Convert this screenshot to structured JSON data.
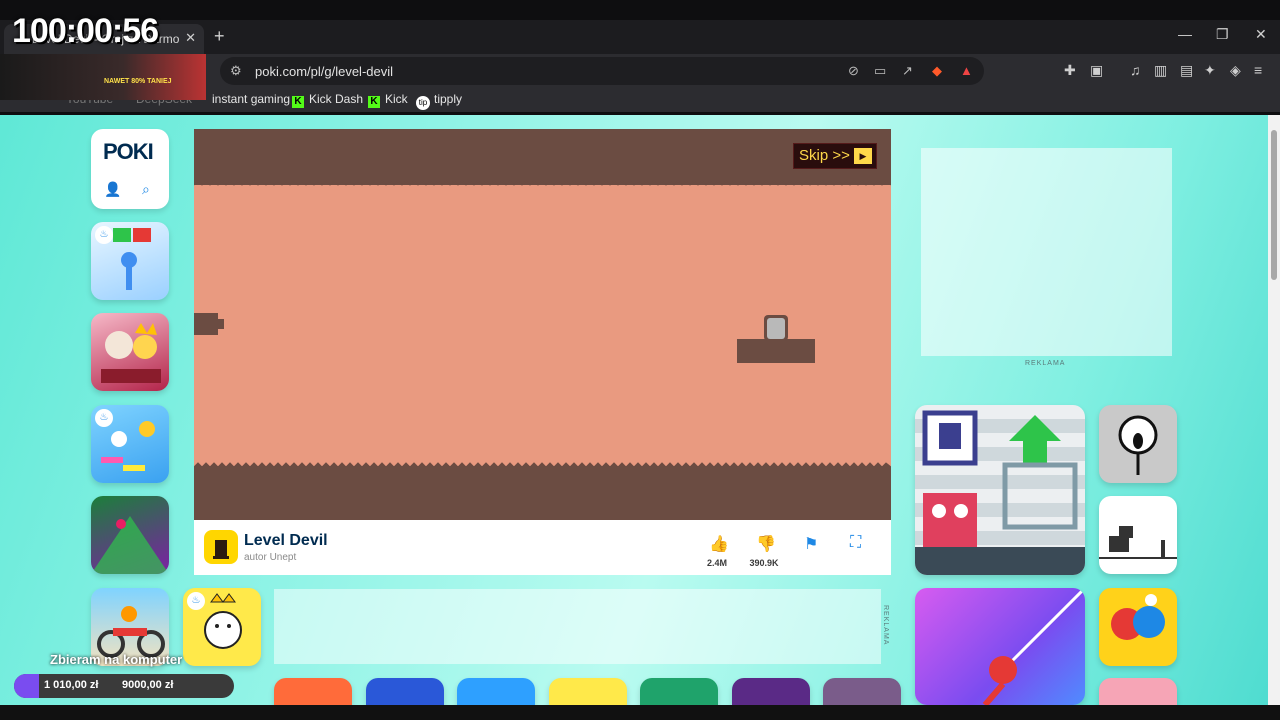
{
  "overlay": {
    "timer": "100:00:56",
    "promo_text": "NAWET 80% TANIEJ",
    "donation_label": "Zbieram na komputer",
    "donation_current": "1 010,00 zł",
    "donation_goal": "9000,00 zł",
    "donation_progress": 0.112
  },
  "browser": {
    "tab_title": "Level Devil - Graj za Darmo",
    "new_tab_symbol": "+",
    "url": "poki.com/pl/g/level-devil",
    "bookmarks": [
      {
        "label": "YouTube"
      },
      {
        "label": "DeepSeek"
      },
      {
        "label": "instant gaming"
      },
      {
        "label": "Kick Dash"
      },
      {
        "label": "Kick"
      },
      {
        "label": "tipply"
      }
    ]
  },
  "page": {
    "logo": "POKI",
    "skip_label": "Skip >>",
    "game": {
      "title": "Level Devil",
      "author": "autor Unept",
      "likes": "2.4M",
      "dislikes": "390.9K"
    },
    "ad_label": "REKLAMA",
    "colors": {
      "accent": "#1e88e5",
      "game_bg": "#e99a80",
      "game_ground": "#6b4c42",
      "page_bg": "#8ff3e6"
    }
  }
}
